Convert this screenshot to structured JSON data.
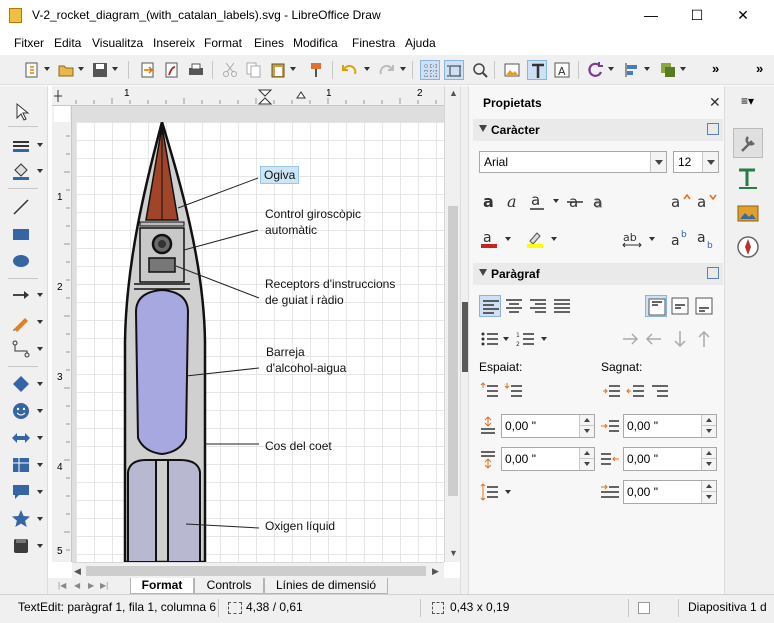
{
  "window": {
    "title": "V-2_rocket_diagram_(with_catalan_labels).svg - LibreOffice Draw",
    "minimize": "—",
    "maximize": "☐",
    "close": "✕"
  },
  "menu": [
    "Fitxer",
    "Edita",
    "Visualitza",
    "Insereix",
    "Format",
    "Eines",
    "Modifica",
    "Finestra",
    "Ajuda"
  ],
  "toolbar": {
    "overflow": "»",
    "sidebar_overflow": "»"
  },
  "ruler": {
    "top_ticks": [
      "1",
      "1",
      "2"
    ],
    "left_ticks": [
      "1",
      "2",
      "3",
      "4",
      "5"
    ]
  },
  "canvas": {
    "labels": [
      {
        "text": "Ogiva"
      },
      {
        "text": "Control giroscòpic\nautomàtic"
      },
      {
        "text": "Receptors d'instruccions\nde guiat i ràdio"
      },
      {
        "text": "Barreja\nd'alcohol-aigua"
      },
      {
        "text": "Cos del coet"
      },
      {
        "text": "Oxigen líquid"
      }
    ],
    "colors": {
      "nose": "#a0442a",
      "fuel": "#a8a8e0",
      "oxygen": "#b8b8d0",
      "body": "#d0d0d0"
    }
  },
  "tabs": [
    "Format",
    "Controls",
    "Línies de dimensió"
  ],
  "sidebar": {
    "title": "Propietats",
    "close": "✕",
    "character": {
      "heading": "Caràcter",
      "font": "Arial",
      "size": "12"
    },
    "paragraph": {
      "heading": "Paràgraf",
      "spacing_label": "Espaiat:",
      "indent_label": "Sagnat:",
      "above": "0,00 \"",
      "below": "0,00 \"",
      "before_text": "0,00 \"",
      "after_text": "0,00 \"",
      "first_line": "0,00 \""
    }
  },
  "status": {
    "edit": "TextEdit: paràgraf 1, fila 1, columna 6",
    "position": "4,38 / 0,61",
    "size": "0,43 x 0,19",
    "slide": "Diapositiva 1 d"
  }
}
